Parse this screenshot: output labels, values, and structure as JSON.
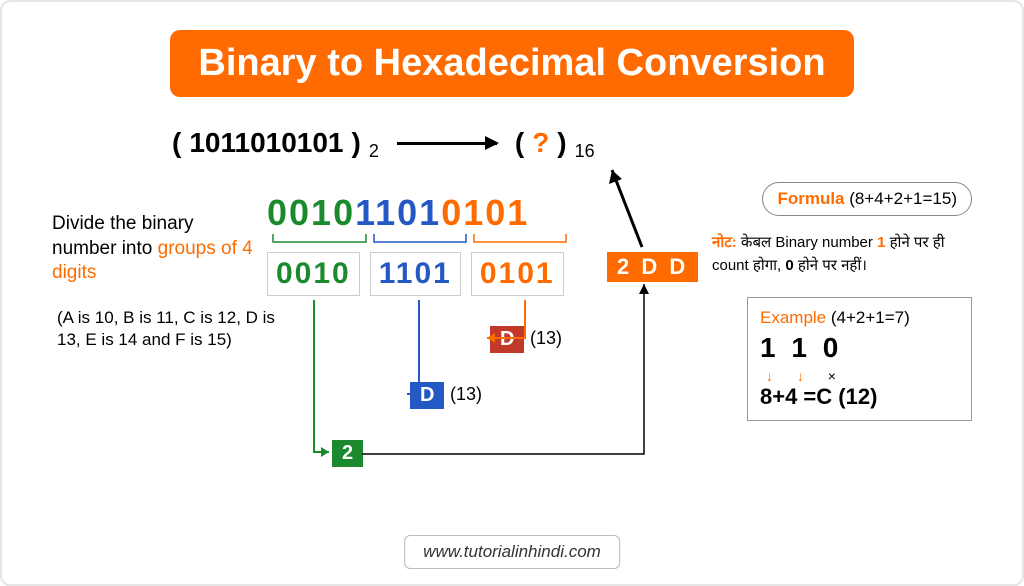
{
  "title": "Binary to Hexadecimal Conversion",
  "problem": {
    "open": "(",
    "binary": "1011010101",
    "close": ")",
    "base_from": "2",
    "open2": "(",
    "question": "?",
    "close2": ")",
    "base_to": "16"
  },
  "padded_binary": {
    "group1": "0010",
    "group2": "1101",
    "group3": "0101"
  },
  "instruction": {
    "part1": "Divide the binary number into ",
    "highlight": "groups of 4 digits"
  },
  "hex_map": "(A is 10, B is 11, C is 12, D is 13, E is 14 and F is 15)",
  "conversion": {
    "group1_val": "2",
    "group2_val": "D",
    "group2_dec": "(13)",
    "group3_val": "D",
    "group3_dec": "(13)"
  },
  "result": "2 D D",
  "formula": {
    "label": "Formula",
    "expr": "(8+4+2+1=15)"
  },
  "note": {
    "label": "नोट:",
    "text1": " केबल Binary number ",
    "one": "1",
    "text2": " होने पर ही count होगा, ",
    "zero": "0",
    "text3": " होने पर नहीं।"
  },
  "example": {
    "label": "Example",
    "expr": "(4+2+1=7)",
    "bits": "1 1 0",
    "arrows": "↓ ↓",
    "cross": "×",
    "calc": "8+4  =C (12)"
  },
  "website": "www.tutorialinhindi.com"
}
